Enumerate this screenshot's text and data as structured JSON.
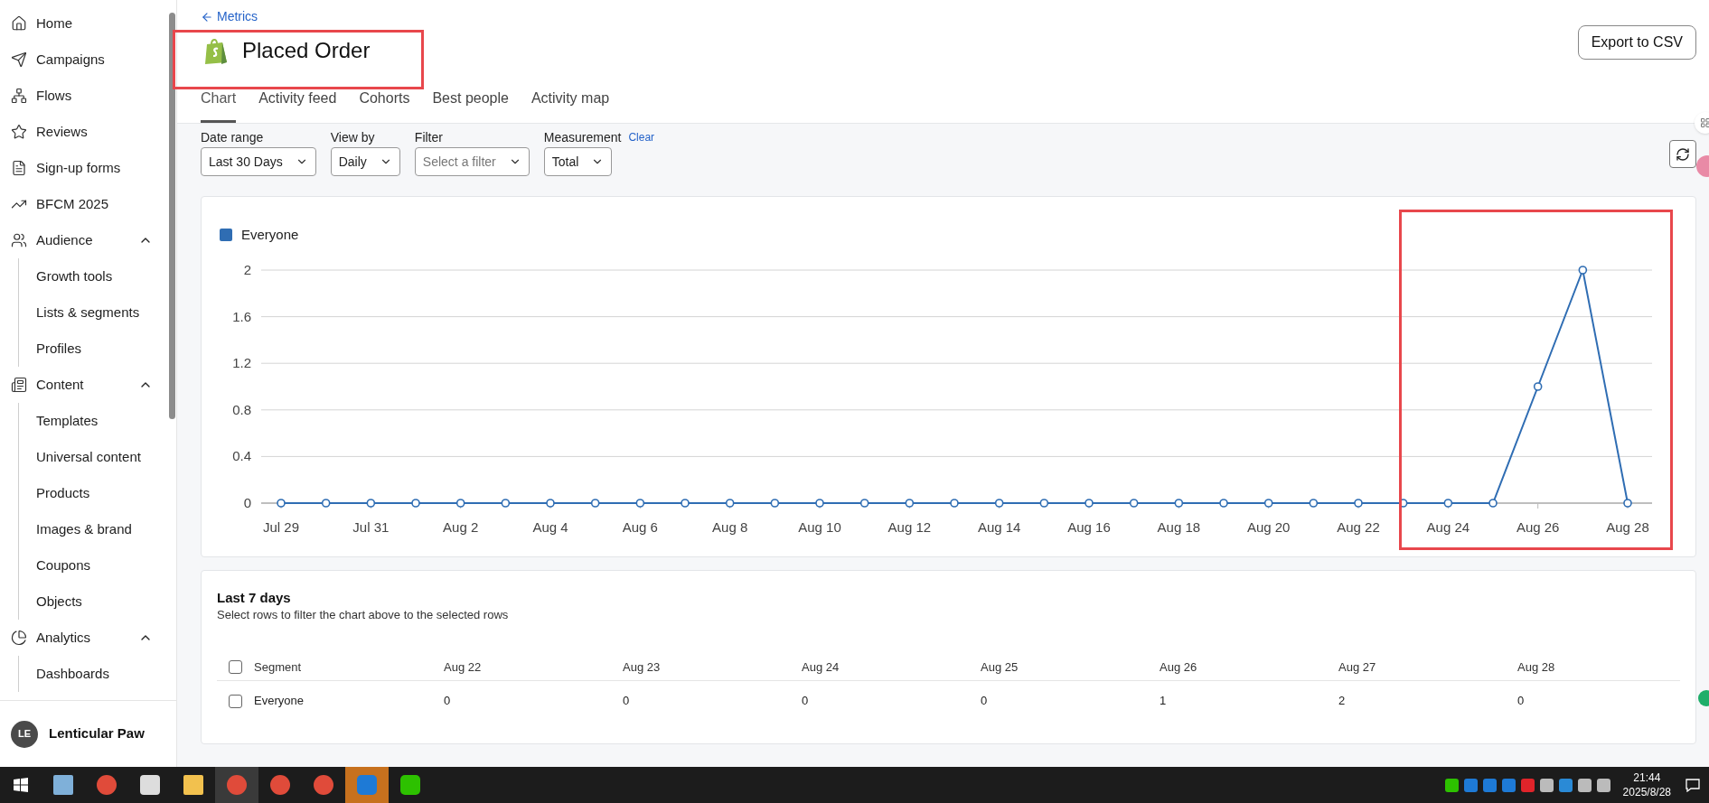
{
  "sidebar": {
    "items": [
      {
        "label": "Home"
      },
      {
        "label": "Campaigns"
      },
      {
        "label": "Flows"
      },
      {
        "label": "Reviews"
      },
      {
        "label": "Sign-up forms"
      },
      {
        "label": "BFCM 2025"
      },
      {
        "label": "Audience",
        "expanded": true,
        "children": [
          {
            "label": "Growth tools"
          },
          {
            "label": "Lists & segments"
          },
          {
            "label": "Profiles"
          }
        ]
      },
      {
        "label": "Content",
        "expanded": true,
        "children": [
          {
            "label": "Templates"
          },
          {
            "label": "Universal content"
          },
          {
            "label": "Products"
          },
          {
            "label": "Images & brand"
          },
          {
            "label": "Coupons"
          },
          {
            "label": "Objects"
          }
        ]
      },
      {
        "label": "Analytics",
        "expanded": true,
        "children": [
          {
            "label": "Dashboards"
          }
        ]
      }
    ],
    "footer": {
      "avatar": "LE",
      "name": "Lenticular Paw"
    }
  },
  "header": {
    "back_link": "Metrics",
    "title": "Placed Order",
    "export_button": "Export to CSV"
  },
  "tabs": [
    {
      "label": "Chart",
      "selected": true
    },
    {
      "label": "Activity feed",
      "selected": false
    },
    {
      "label": "Cohorts",
      "selected": false
    },
    {
      "label": "Best people",
      "selected": false
    },
    {
      "label": "Activity map",
      "selected": false
    }
  ],
  "filters": [
    {
      "label": "Date range",
      "value": "Last 30 Days"
    },
    {
      "label": "View by",
      "value": "Daily"
    },
    {
      "label": "Filter",
      "placeholder": "Select a filter"
    },
    {
      "label": "Measurement",
      "value": "Total",
      "action": "Clear"
    }
  ],
  "chart": {
    "chart_data": {
      "type": "line",
      "grid": true,
      "categories": [
        "Jul 29",
        null,
        "Jul 31",
        null,
        "Aug 2",
        null,
        "Aug 4",
        null,
        "Aug 6",
        null,
        "Aug 8",
        null,
        "Aug 10",
        null,
        "Aug 12",
        null,
        "Aug 14",
        null,
        "Aug 16",
        null,
        "Aug 18",
        null,
        "Aug 20",
        null,
        "Aug 22",
        null,
        "Aug 24",
        null,
        "Aug 26",
        null,
        "Aug 28"
      ],
      "series": [
        {
          "name": "Everyone",
          "color": "#2f6db3",
          "marker": true,
          "values": [
            0,
            0,
            0,
            0,
            0,
            0,
            0,
            0,
            0,
            0,
            0,
            0,
            0,
            0,
            0,
            0,
            0,
            0,
            0,
            0,
            0,
            0,
            0,
            0,
            0,
            0,
            0,
            0,
            1,
            2,
            0
          ]
        }
      ],
      "ylim": [
        0,
        2
      ],
      "yticks": [
        0,
        0.4,
        0.8,
        1.2,
        1.6,
        2
      ]
    }
  },
  "table_card": {
    "title": "Last 7 days",
    "subtitle": "Select rows to filter the chart above to the selected rows",
    "header_checked": false,
    "columns": [
      "Segment",
      "Aug 22",
      "Aug 23",
      "Aug 24",
      "Aug 25",
      "Aug 26",
      "Aug 27",
      "Aug 28"
    ],
    "rows": [
      {
        "checked": false,
        "cells": [
          "Everyone",
          "0",
          "0",
          "0",
          "0",
          "1",
          "2",
          "0"
        ]
      }
    ]
  },
  "taskbar": {
    "time": "21:44",
    "date": "2025/8/28"
  }
}
